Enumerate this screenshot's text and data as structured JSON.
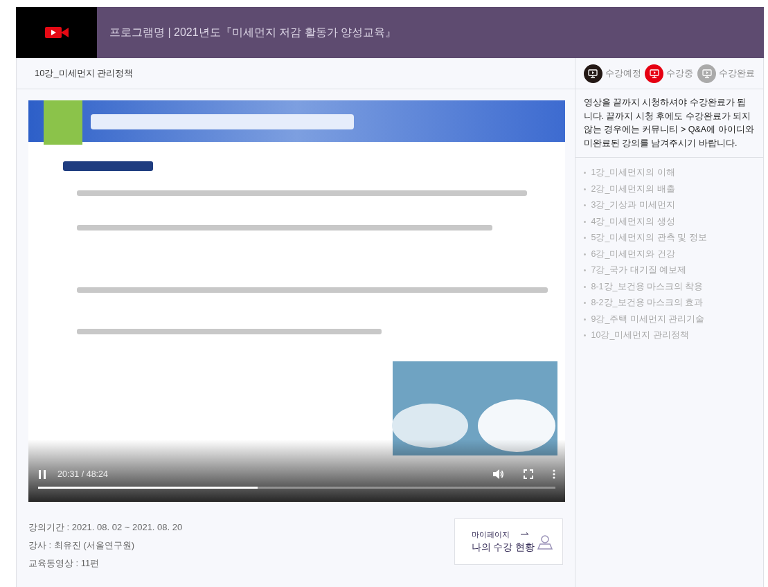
{
  "header": {
    "title": "프로그램명 | 2021년도『미세먼지 저감 활동가 양성교육』"
  },
  "lesson_title": "10강_미세먼지 관리정책",
  "player": {
    "kind": "picture",
    "playing": true,
    "time": "20:31 / 48:24",
    "level": 0.425
  },
  "info": [
    "강의기간 : 2021. 08. 02 ~ 2021. 08. 20",
    "강사 : 최유진 (서울연구원)",
    "교육동영상 : 11편"
  ],
  "mypage_button": {
    "caption": "마이페이지",
    "label": "나의 수강 현황"
  },
  "legend": [
    {
      "label": "수강예정",
      "color": "#231815"
    },
    {
      "label": "수강중",
      "color": "#e60012"
    },
    {
      "label": "수강완료",
      "color": "#aaaaaa"
    }
  ],
  "notice": "영상을 끝까지 시청하셔야 수강완료가 됩니다. 끝까지 시청 후에도 수강완료가 되지 않는 경우에는 커뮤니티 > Q&A에 아이디와 미완료된 강의를 남겨주시기 바랍니다.",
  "lectures": [
    "1강_미세먼지의 이해",
    "2강_미세먼지의 배출",
    "3강_기상과 미세먼지",
    "4강_미세먼지의 생성",
    "5강_미세먼지의 관측 및 정보",
    "6강_미세먼지와 건강",
    "7강_국가 대기질 예보제",
    "8-1강_보건용 마스크의 착용",
    "8-2강_보건용 마스크의 효과",
    "9강_주택 미세먼지 관리기술",
    "10강_미세먼지 관리정책"
  ]
}
